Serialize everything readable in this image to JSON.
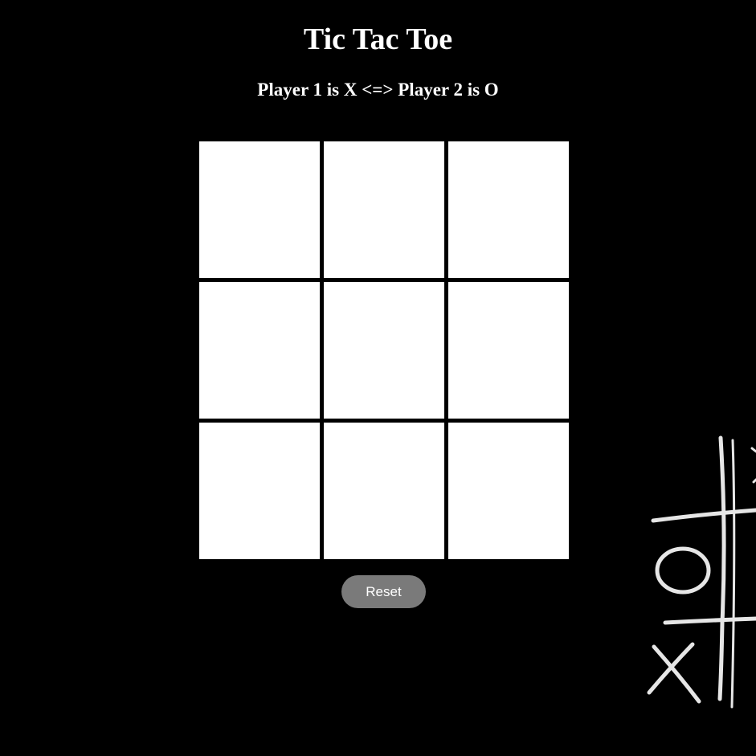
{
  "header": {
    "title": "Tic Tac Toe",
    "subtitle": "Player 1 is X <=> Player 2 is O"
  },
  "board": {
    "cells": [
      "",
      "",
      "",
      "",
      "",
      "",
      "",
      "",
      ""
    ]
  },
  "controls": {
    "reset_label": "Reset"
  },
  "decoration": {
    "icon": "tic-tac-toe-sketch-icon",
    "stroke_color": "#e6e6e6"
  },
  "colors": {
    "background": "#000000",
    "cell": "#ffffff",
    "button": "#7a7a7a",
    "text": "#ffffff"
  }
}
